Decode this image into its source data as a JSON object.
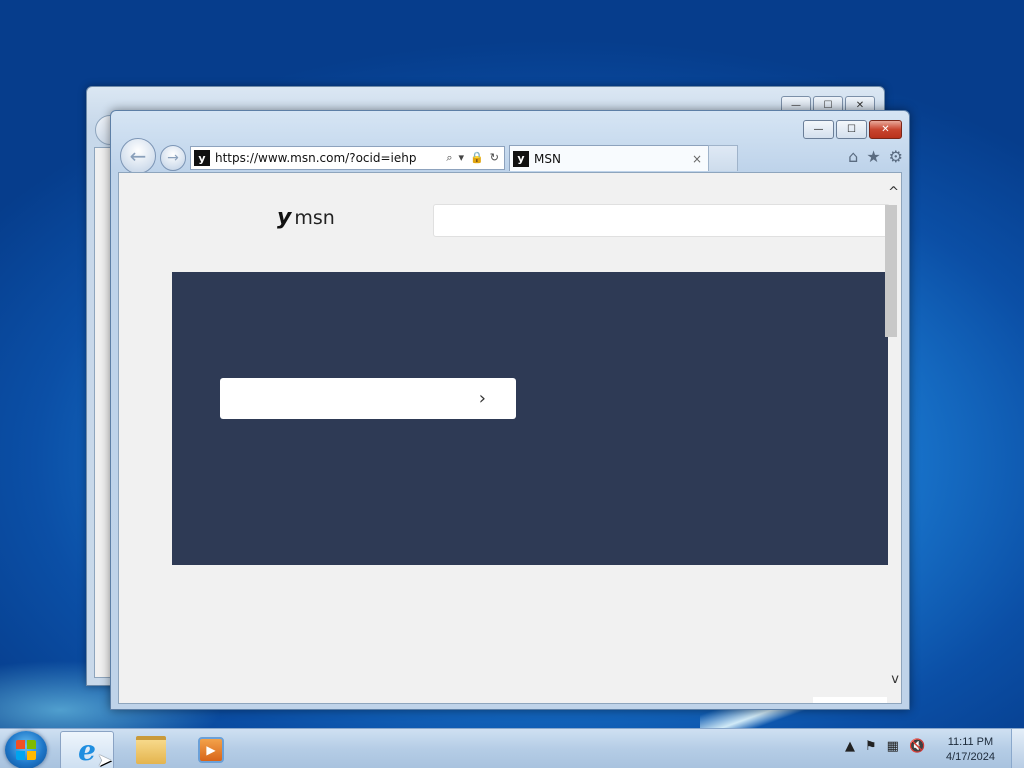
{
  "browser": {
    "address_url": "https://www.msn.com/?ocid=iehp",
    "favicon_glyph": "y",
    "tab_title": "MSN",
    "tab_close": "×",
    "search_icon": "⌕",
    "dropdown_icon": "▾",
    "lock_icon": "🔒",
    "refresh_icon": "↻",
    "home_icon": "⌂",
    "favorites_icon": "★",
    "settings_icon": "⚙",
    "back_icon": "←",
    "forward_icon": "→"
  },
  "window_controls": {
    "minimize": "—",
    "maximize": "☐",
    "close": "✕"
  },
  "page": {
    "logo_text": "msn",
    "logo_icon": "y",
    "hero_button_chevron": "›",
    "scroll_up": "^",
    "scroll_down": "v"
  },
  "taskbar": {
    "ie_glyph": "e",
    "media_glyph": "▶",
    "clock_time": "11:11 PM",
    "clock_date": "4/17/2024",
    "tray": {
      "show_hidden": "▲",
      "flag_icon": "⚑",
      "network_icon": "▦",
      "volume_icon": "🔇"
    }
  },
  "colors": {
    "hero_bg": "#2e3a55",
    "page_bg": "#f1f1f1",
    "close_button": "#c8452f"
  }
}
